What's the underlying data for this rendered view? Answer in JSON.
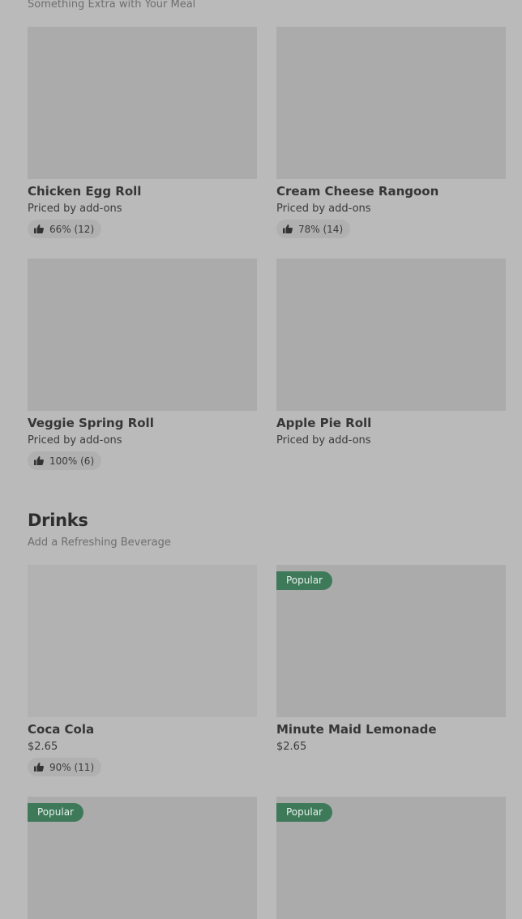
{
  "sections": [
    {
      "subtitle": "Something Extra with Your Meal",
      "items": [
        {
          "name": "Chicken Egg Roll",
          "price": "Priced by add-ons",
          "rating": "66% (12)"
        },
        {
          "name": "Cream Cheese Rangoon",
          "price": "Priced by add-ons",
          "rating": "78% (14)"
        },
        {
          "name": "Veggie Spring Roll",
          "price": "Priced by add-ons",
          "rating": "100% (6)"
        },
        {
          "name": "Apple Pie Roll",
          "price": "Priced by add-ons"
        }
      ]
    },
    {
      "title": "Drinks",
      "subtitle": "Add a Refreshing Beverage",
      "popular_label": "Popular",
      "items": [
        {
          "name": "Coca Cola",
          "price": "$2.65",
          "rating": "90% (11)"
        },
        {
          "name": "Minute Maid Lemonade",
          "price": "$2.65",
          "popular": true
        }
      ]
    }
  ],
  "icons": {
    "rating": "thumbs-up-icon"
  },
  "colors": {
    "popular_badge": "#3e7a5a",
    "background": "#bababa",
    "image_placeholder": "#ababab"
  }
}
